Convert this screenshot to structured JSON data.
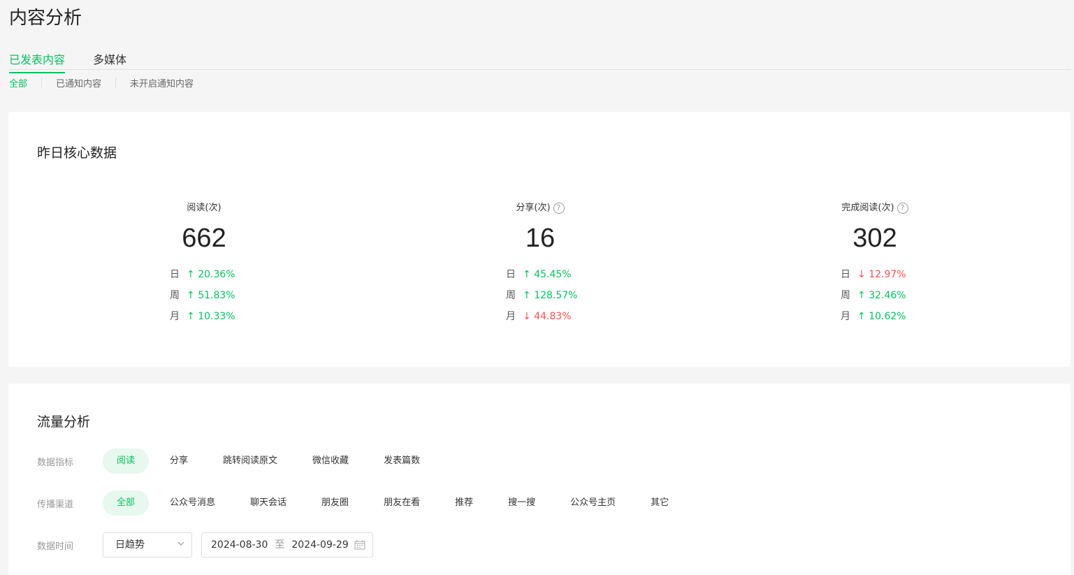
{
  "page_title": "内容分析",
  "tabs": [
    {
      "label": "已发表内容",
      "active": true
    },
    {
      "label": "多媒体",
      "active": false
    }
  ],
  "subtabs": [
    {
      "label": "全部",
      "active": true
    },
    {
      "label": "已通知内容",
      "active": false
    },
    {
      "label": "未开启通知内容",
      "active": false
    }
  ],
  "core": {
    "title": "昨日核心数据",
    "metrics": [
      {
        "label": "阅读(次)",
        "help": false,
        "value": "662",
        "compare": [
          {
            "label": "日",
            "direction": "up",
            "arrow": "↑",
            "value": "20.36%"
          },
          {
            "label": "周",
            "direction": "up",
            "arrow": "↑",
            "value": "51.83%"
          },
          {
            "label": "月",
            "direction": "up",
            "arrow": "↑",
            "value": "10.33%"
          }
        ]
      },
      {
        "label": "分享(次)",
        "help": true,
        "value": "16",
        "compare": [
          {
            "label": "日",
            "direction": "up",
            "arrow": "↑",
            "value": "45.45%"
          },
          {
            "label": "周",
            "direction": "up",
            "arrow": "↑",
            "value": "128.57%"
          },
          {
            "label": "月",
            "direction": "down",
            "arrow": "↓",
            "value": "44.83%"
          }
        ]
      },
      {
        "label": "完成阅读(次)",
        "help": true,
        "value": "302",
        "compare": [
          {
            "label": "日",
            "direction": "down",
            "arrow": "↓",
            "value": "12.97%"
          },
          {
            "label": "周",
            "direction": "up",
            "arrow": "↑",
            "value": "32.46%"
          },
          {
            "label": "月",
            "direction": "up",
            "arrow": "↑",
            "value": "10.62%"
          }
        ]
      }
    ]
  },
  "traffic": {
    "title": "流量分析",
    "indicator": {
      "label": "数据指标",
      "options": [
        "阅读",
        "分享",
        "跳转阅读原文",
        "微信收藏",
        "发表篇数"
      ],
      "selected": 0
    },
    "channel": {
      "label": "传播渠道",
      "options": [
        "全部",
        "公众号消息",
        "聊天会话",
        "朋友圈",
        "朋友在看",
        "推荐",
        "搜一搜",
        "公众号主页",
        "其它"
      ],
      "selected": 0
    },
    "time": {
      "label": "数据时间",
      "mode": "日趋势",
      "start": "2024-08-30",
      "to": "至",
      "end": "2024-09-29"
    }
  },
  "colors": {
    "accent": "#07c160",
    "down": "#fa5151"
  }
}
